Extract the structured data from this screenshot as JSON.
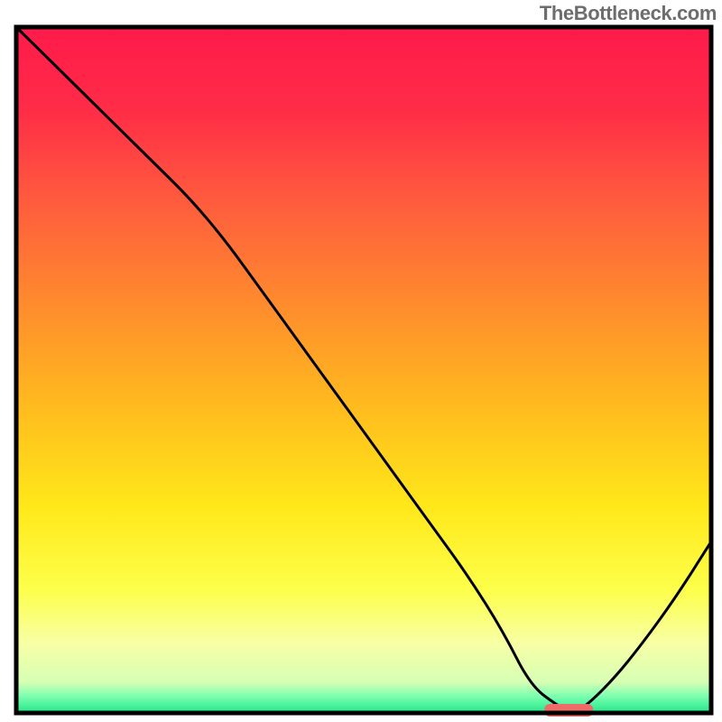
{
  "attribution": "TheBottleneck.com",
  "chart_data": {
    "type": "line",
    "title": "",
    "xlabel": "",
    "ylabel": "",
    "xlim": [
      0,
      100
    ],
    "ylim": [
      0,
      100
    ],
    "grid": false,
    "legend": false,
    "x": [
      0,
      5,
      10,
      15,
      20,
      25,
      30,
      35,
      40,
      45,
      50,
      55,
      60,
      65,
      70,
      74,
      78,
      80,
      82,
      86,
      90,
      95,
      100
    ],
    "values": [
      100,
      95,
      90,
      85,
      80,
      75,
      69,
      62,
      55,
      48,
      41,
      34,
      27,
      20,
      12,
      4,
      1,
      0,
      1,
      5,
      10,
      17,
      25
    ],
    "optimal_zone": {
      "x_start": 76,
      "x_end": 83,
      "y": 0
    },
    "background_stops": [
      {
        "pos": 0.0,
        "color": "#ff1a4b"
      },
      {
        "pos": 0.12,
        "color": "#ff2c47"
      },
      {
        "pos": 0.25,
        "color": "#ff5a3e"
      },
      {
        "pos": 0.4,
        "color": "#ff8a2e"
      },
      {
        "pos": 0.55,
        "color": "#ffba1e"
      },
      {
        "pos": 0.7,
        "color": "#ffe81a"
      },
      {
        "pos": 0.82,
        "color": "#fdff4a"
      },
      {
        "pos": 0.9,
        "color": "#f7ffa6"
      },
      {
        "pos": 0.955,
        "color": "#d6ffb4"
      },
      {
        "pos": 0.975,
        "color": "#7fffb0"
      },
      {
        "pos": 1.0,
        "color": "#20e88a"
      }
    ],
    "marker_color": "#f06a6a",
    "curve_color": "#000000",
    "frame_color": "#000000"
  }
}
